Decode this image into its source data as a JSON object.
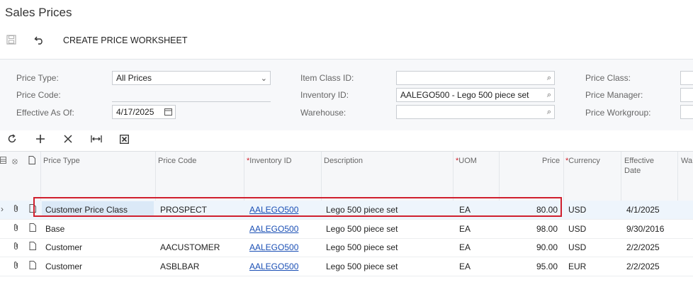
{
  "page": {
    "title": "Sales Prices"
  },
  "toolbar": {
    "save_icon": "save-icon",
    "undo_icon": "undo-icon",
    "create_worksheet_label": "CREATE PRICE WORKSHEET"
  },
  "filters": {
    "price_type": {
      "label": "Price Type:",
      "value": "All Prices"
    },
    "price_code": {
      "label": "Price Code:",
      "value": ""
    },
    "effective_as_of": {
      "label": "Effective As Of:",
      "value": "4/17/2025"
    },
    "item_class_id": {
      "label": "Item Class ID:",
      "value": ""
    },
    "inventory_id": {
      "label": "Inventory ID:",
      "value": "AALEGO500 - Lego 500 piece set"
    },
    "warehouse": {
      "label": "Warehouse:",
      "value": ""
    },
    "price_class": {
      "label": "Price Class:",
      "value": ""
    },
    "price_manager": {
      "label": "Price Manager:",
      "value": ""
    },
    "price_workgroup": {
      "label": "Price Workgroup:",
      "value": ""
    }
  },
  "grid_toolbar": [
    "refresh-icon",
    "add-icon",
    "delete-icon",
    "fit-columns-icon",
    "export-excel-icon"
  ],
  "columns": {
    "price_type": "Price Type",
    "price_code": "Price Code",
    "inventory_id": "Inventory ID",
    "description": "Description",
    "uom": "UOM",
    "price": "Price",
    "currency": "Currency",
    "effective_date": "Effective Date",
    "warehouse": "Wa"
  },
  "rows": [
    {
      "price_type": "Customer Price Class",
      "price_code": "PROSPECT",
      "inventory_id": "AALEGO500",
      "description": "Lego 500 piece set",
      "uom": "EA",
      "price": "80.00",
      "currency": "USD",
      "effective_date": "4/1/2025"
    },
    {
      "price_type": "Base",
      "price_code": "",
      "inventory_id": "AALEGO500",
      "description": "Lego 500 piece set",
      "uom": "EA",
      "price": "98.00",
      "currency": "USD",
      "effective_date": "9/30/2016"
    },
    {
      "price_type": "Customer",
      "price_code": "AACUSTOMER",
      "inventory_id": "AALEGO500",
      "description": "Lego 500 piece set",
      "uom": "EA",
      "price": "90.00",
      "currency": "USD",
      "effective_date": "2/2/2025"
    },
    {
      "price_type": "Customer",
      "price_code": "ASBLBAR",
      "inventory_id": "AALEGO500",
      "description": "Lego 500 piece set",
      "uom": "EA",
      "price": "95.00",
      "currency": "EUR",
      "effective_date": "2/2/2025"
    }
  ],
  "colors": {
    "highlight": "#d0202e",
    "link": "#1a4fb5"
  }
}
